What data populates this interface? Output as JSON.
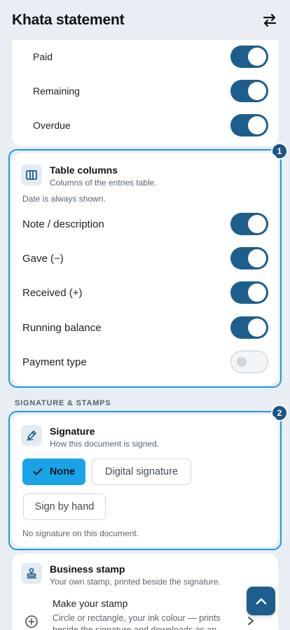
{
  "header": {
    "title": "Khata statement",
    "swap_icon": "swap-arrows-icon"
  },
  "top_card": {
    "rows": [
      {
        "label": "Paid",
        "on": true
      },
      {
        "label": "Remaining",
        "on": true
      },
      {
        "label": "Overdue",
        "on": true
      }
    ]
  },
  "table_columns": {
    "badge": "1",
    "title": "Table columns",
    "subtitle": "Columns of the entries table.",
    "note": "Date is always shown.",
    "rows": [
      {
        "label": "Note / description",
        "on": true
      },
      {
        "label": "Gave (−)",
        "on": true
      },
      {
        "label": "Received (+)",
        "on": true
      },
      {
        "label": "Running balance",
        "on": true
      },
      {
        "label": "Payment type",
        "on": false
      }
    ]
  },
  "section_label": "SIGNATURE & STAMPS",
  "signature": {
    "badge": "2",
    "title": "Signature",
    "subtitle": "How this document is signed.",
    "options": [
      "None",
      "Digital signature",
      "Sign by hand"
    ],
    "selected": "None",
    "status": "No signature on this document."
  },
  "business_stamp": {
    "title": "Business stamp",
    "subtitle": "Your own stamp, printed beside the signature.",
    "make_title": "Make your stamp",
    "make_desc": "Circle or rectangle, your ink colour — prints beside the signature and downloads as an"
  },
  "colors": {
    "accent": "#1e5e8c",
    "highlight": "#1e9bd7",
    "selected_chip": "#1aa3e6"
  }
}
